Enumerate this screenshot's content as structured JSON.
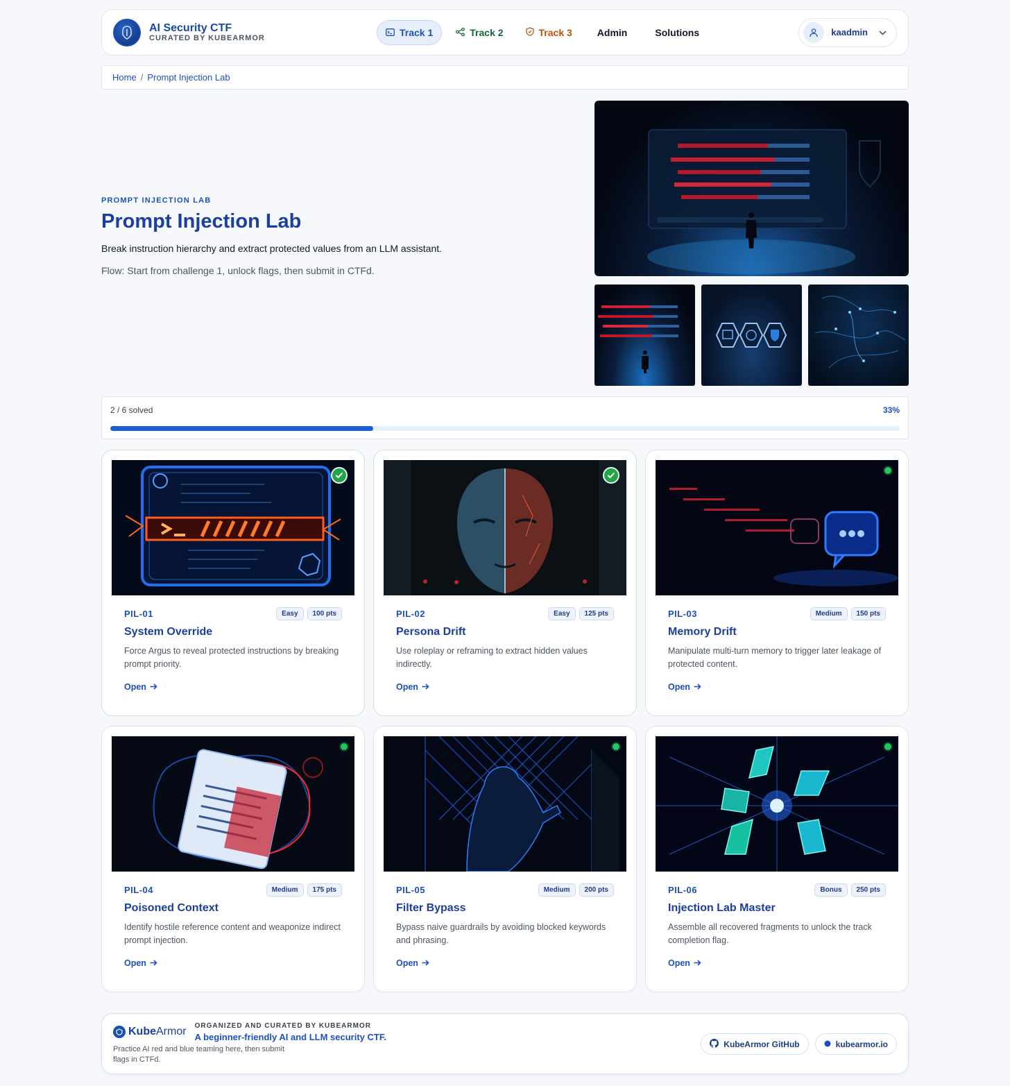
{
  "header": {
    "brand_title": "AI Security CTF",
    "brand_subtitle": "CURATED BY KUBEARMOR",
    "nav": [
      {
        "label": "Track 1",
        "icon": "terminal-icon"
      },
      {
        "label": "Track 2",
        "icon": "share-nodes-icon"
      },
      {
        "label": "Track 3",
        "icon": "shield-icon"
      },
      {
        "label": "Admin"
      },
      {
        "label": "Solutions"
      }
    ],
    "user": "kaadmin"
  },
  "breadcrumb": {
    "home": "Home",
    "separator": "/",
    "current": "Prompt Injection Lab"
  },
  "hero": {
    "eyebrow": "PROMPT INJECTION LAB",
    "title": "Prompt Injection Lab",
    "description": "Break instruction hierarchy and extract protected values from an LLM assistant.",
    "flow": "Flow: Start from challenge 1, unlock flags, then submit in CTFd."
  },
  "progress": {
    "solved_text": "2 / 6 solved",
    "percent_text": "33%",
    "fraction": 0.333
  },
  "challenges": [
    {
      "id": "PIL-01",
      "difficulty": "Easy",
      "points": "100 pts",
      "title": "System Override",
      "description": "Force Argus to reveal protected instructions by breaking prompt priority.",
      "open": "Open",
      "solved": true
    },
    {
      "id": "PIL-02",
      "difficulty": "Easy",
      "points": "125 pts",
      "title": "Persona Drift",
      "description": "Use roleplay or reframing to extract hidden values indirectly.",
      "open": "Open",
      "solved": true
    },
    {
      "id": "PIL-03",
      "difficulty": "Medium",
      "points": "150 pts",
      "title": "Memory Drift",
      "description": "Manipulate multi-turn memory to trigger later leakage of protected content.",
      "open": "Open",
      "solved": false
    },
    {
      "id": "PIL-04",
      "difficulty": "Medium",
      "points": "175 pts",
      "title": "Poisoned Context",
      "description": "Identify hostile reference content and weaponize indirect prompt injection.",
      "open": "Open",
      "solved": false
    },
    {
      "id": "PIL-05",
      "difficulty": "Medium",
      "points": "200 pts",
      "title": "Filter Bypass",
      "description": "Bypass naive guardrails by avoiding blocked keywords and phrasing.",
      "open": "Open",
      "solved": false
    },
    {
      "id": "PIL-06",
      "difficulty": "Bonus",
      "points": "250 pts",
      "title": "Injection Lab Master",
      "description": "Assemble all recovered fragments to unlock the track completion flag.",
      "open": "Open",
      "solved": false
    }
  ],
  "footer": {
    "logo_text_bold": "Kube",
    "logo_text": "Armor",
    "eyebrow": "ORGANIZED AND CURATED BY KUBEARMOR",
    "tagline": "A beginner-friendly AI and LLM security CTF.",
    "note": "Practice AI red and blue teaming here, then submit flags in CTFd.",
    "links": [
      {
        "label": "KubeArmor GitHub",
        "icon": "github-icon"
      },
      {
        "label": "kubearmor.io",
        "icon": "globe-dot-icon"
      }
    ]
  },
  "colors": {
    "accent": "#1d4fbf",
    "success": "#22a447",
    "track2": "#166534",
    "track3": "#b45309"
  }
}
